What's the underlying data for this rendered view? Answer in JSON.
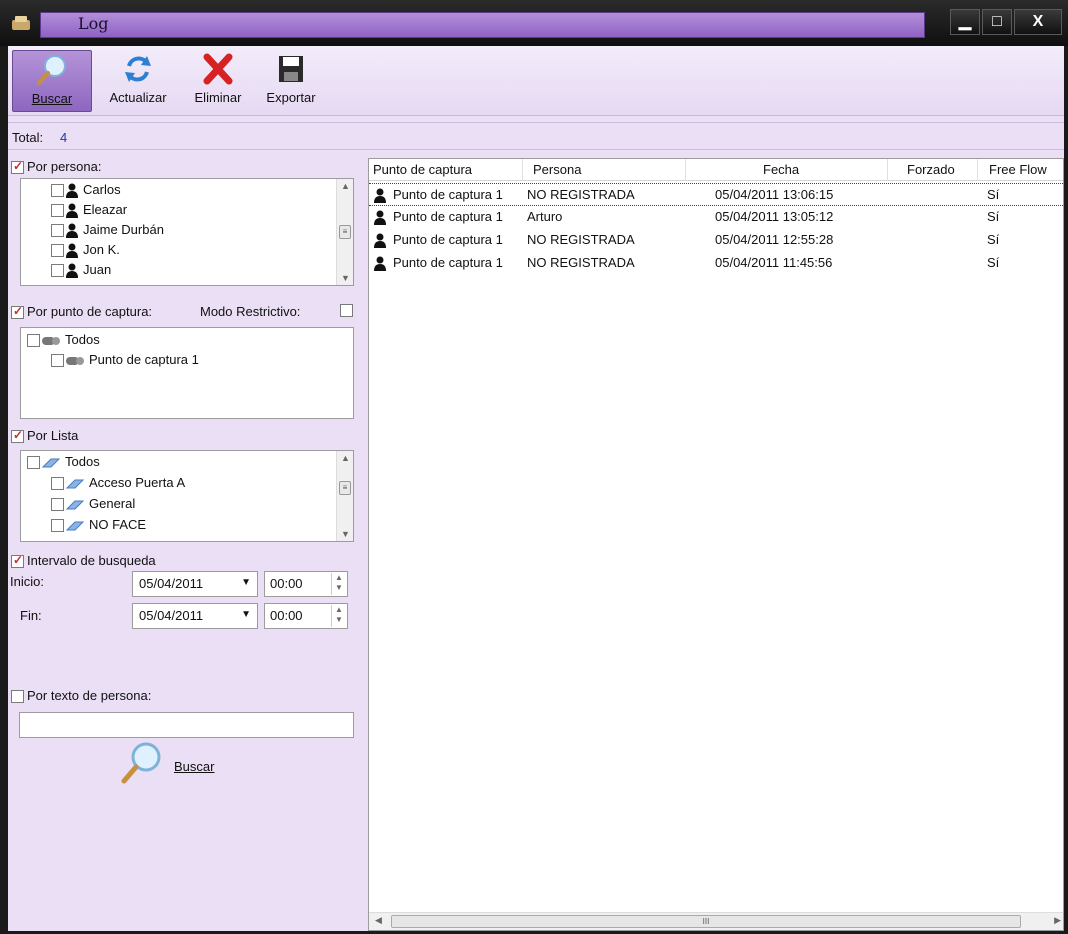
{
  "window": {
    "title": "Log",
    "min": "▁",
    "max": "□",
    "close": "X"
  },
  "toolbar": {
    "search_label": "Buscar",
    "refresh_label": "Actualizar",
    "delete_label": "Eliminar",
    "export_label": "Exportar"
  },
  "total": {
    "label": "Total:",
    "value": "4"
  },
  "filters": {
    "person": {
      "label": "Por persona:",
      "checked": true,
      "items": [
        "Carlos",
        "Eleazar",
        "Jaime Durbán",
        "Jon K.",
        "Juan"
      ]
    },
    "capture_point": {
      "label": "Por punto de captura:",
      "checked": true,
      "restrictive_label": "Modo Restrictivo:",
      "root": "Todos",
      "items": [
        "Punto de captura 1"
      ]
    },
    "list": {
      "label": "Por Lista",
      "checked": true,
      "root": "Todos",
      "items": [
        "Acceso Puerta A",
        "General",
        "NO FACE"
      ]
    },
    "interval": {
      "label": "Intervalo de busqueda",
      "checked": true,
      "start_label": "Inicio:",
      "start_date": "05/04/2011",
      "start_time": "00:00",
      "end_label": "Fin:",
      "end_date": "05/04/2011",
      "end_time": "00:00"
    },
    "person_text": {
      "label": "Por texto de persona:",
      "checked": false,
      "value": ""
    },
    "search_button": "Buscar"
  },
  "grid": {
    "columns": [
      "Punto de captura",
      "Persona",
      "Fecha",
      "Forzado",
      "Free Flow"
    ],
    "rows": [
      [
        "Punto de captura 1",
        "NO REGISTRADA",
        "05/04/2011 13:06:15",
        "",
        "Sí"
      ],
      [
        "Punto de captura 1",
        "Arturo",
        "05/04/2011 13:05:12",
        "",
        "Sí"
      ],
      [
        "Punto de captura 1",
        "NO REGISTRADA",
        "05/04/2011 12:55:28",
        "",
        "Sí"
      ],
      [
        "Punto de captura 1",
        "NO REGISTRADA",
        "05/04/2011 11:45:56",
        "",
        "Sí"
      ]
    ]
  },
  "colors": {
    "accent": "#8f62c4",
    "panel": "#eadff5",
    "link": "#1a3d9e"
  }
}
